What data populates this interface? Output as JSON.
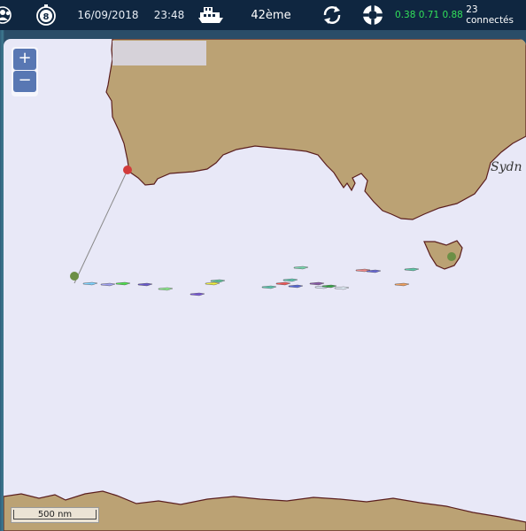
{
  "topbar": {
    "date": "16/09/2018",
    "time": "23:48",
    "rank": "42ème",
    "badge_number": "8",
    "stat1": "0.38",
    "stat2": "0.71",
    "stat3": "0.88",
    "connected": "23 connectés",
    "icons": [
      "users-icon",
      "chronometer-badge-icon",
      "boat-icon",
      "refresh-icon",
      "lifebuoy-icon"
    ]
  },
  "map": {
    "zoom_in": "+",
    "zoom_out": "−",
    "scale_label": "500 nm",
    "place_label": "Sydn",
    "colors": {
      "sea": "#e8e8f7",
      "land": "#bba274",
      "coast": "#5a1e1e",
      "button": "#5877b3"
    }
  }
}
